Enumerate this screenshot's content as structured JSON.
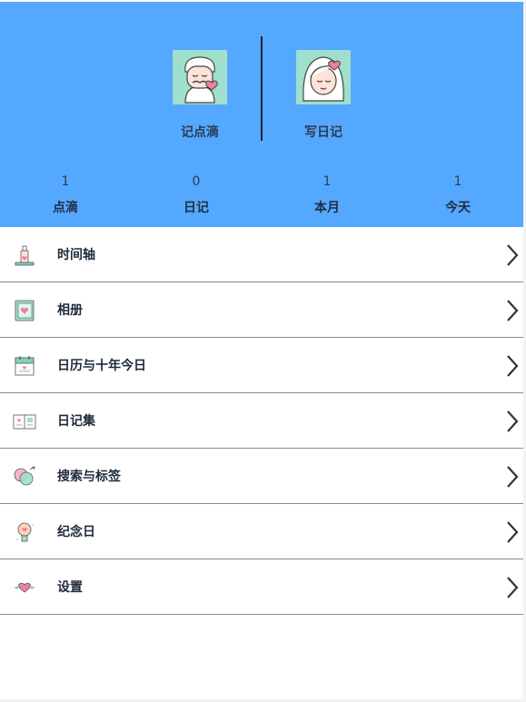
{
  "header": {
    "left_button": {
      "label": "记点滴",
      "icon": "old-man-avatar-icon"
    },
    "right_button": {
      "label": "写日记",
      "icon": "girl-avatar-icon"
    },
    "background_color": "#55a8ff"
  },
  "stats": [
    {
      "value": "1",
      "label": "点滴"
    },
    {
      "value": "0",
      "label": "日记"
    },
    {
      "value": "1",
      "label": "本月"
    },
    {
      "value": "1",
      "label": "今天"
    }
  ],
  "menu": [
    {
      "label": "时间轴",
      "icon": "timeline-bottle-icon"
    },
    {
      "label": "相册",
      "icon": "album-icon"
    },
    {
      "label": "日历与十年今日",
      "icon": "calendar-icon"
    },
    {
      "label": "日记集",
      "icon": "diary-collection-icon"
    },
    {
      "label": "搜索与标签",
      "icon": "search-tag-icon"
    },
    {
      "label": "纪念日",
      "icon": "anniversary-bulb-icon"
    },
    {
      "label": "设置",
      "icon": "settings-heart-icon"
    }
  ]
}
